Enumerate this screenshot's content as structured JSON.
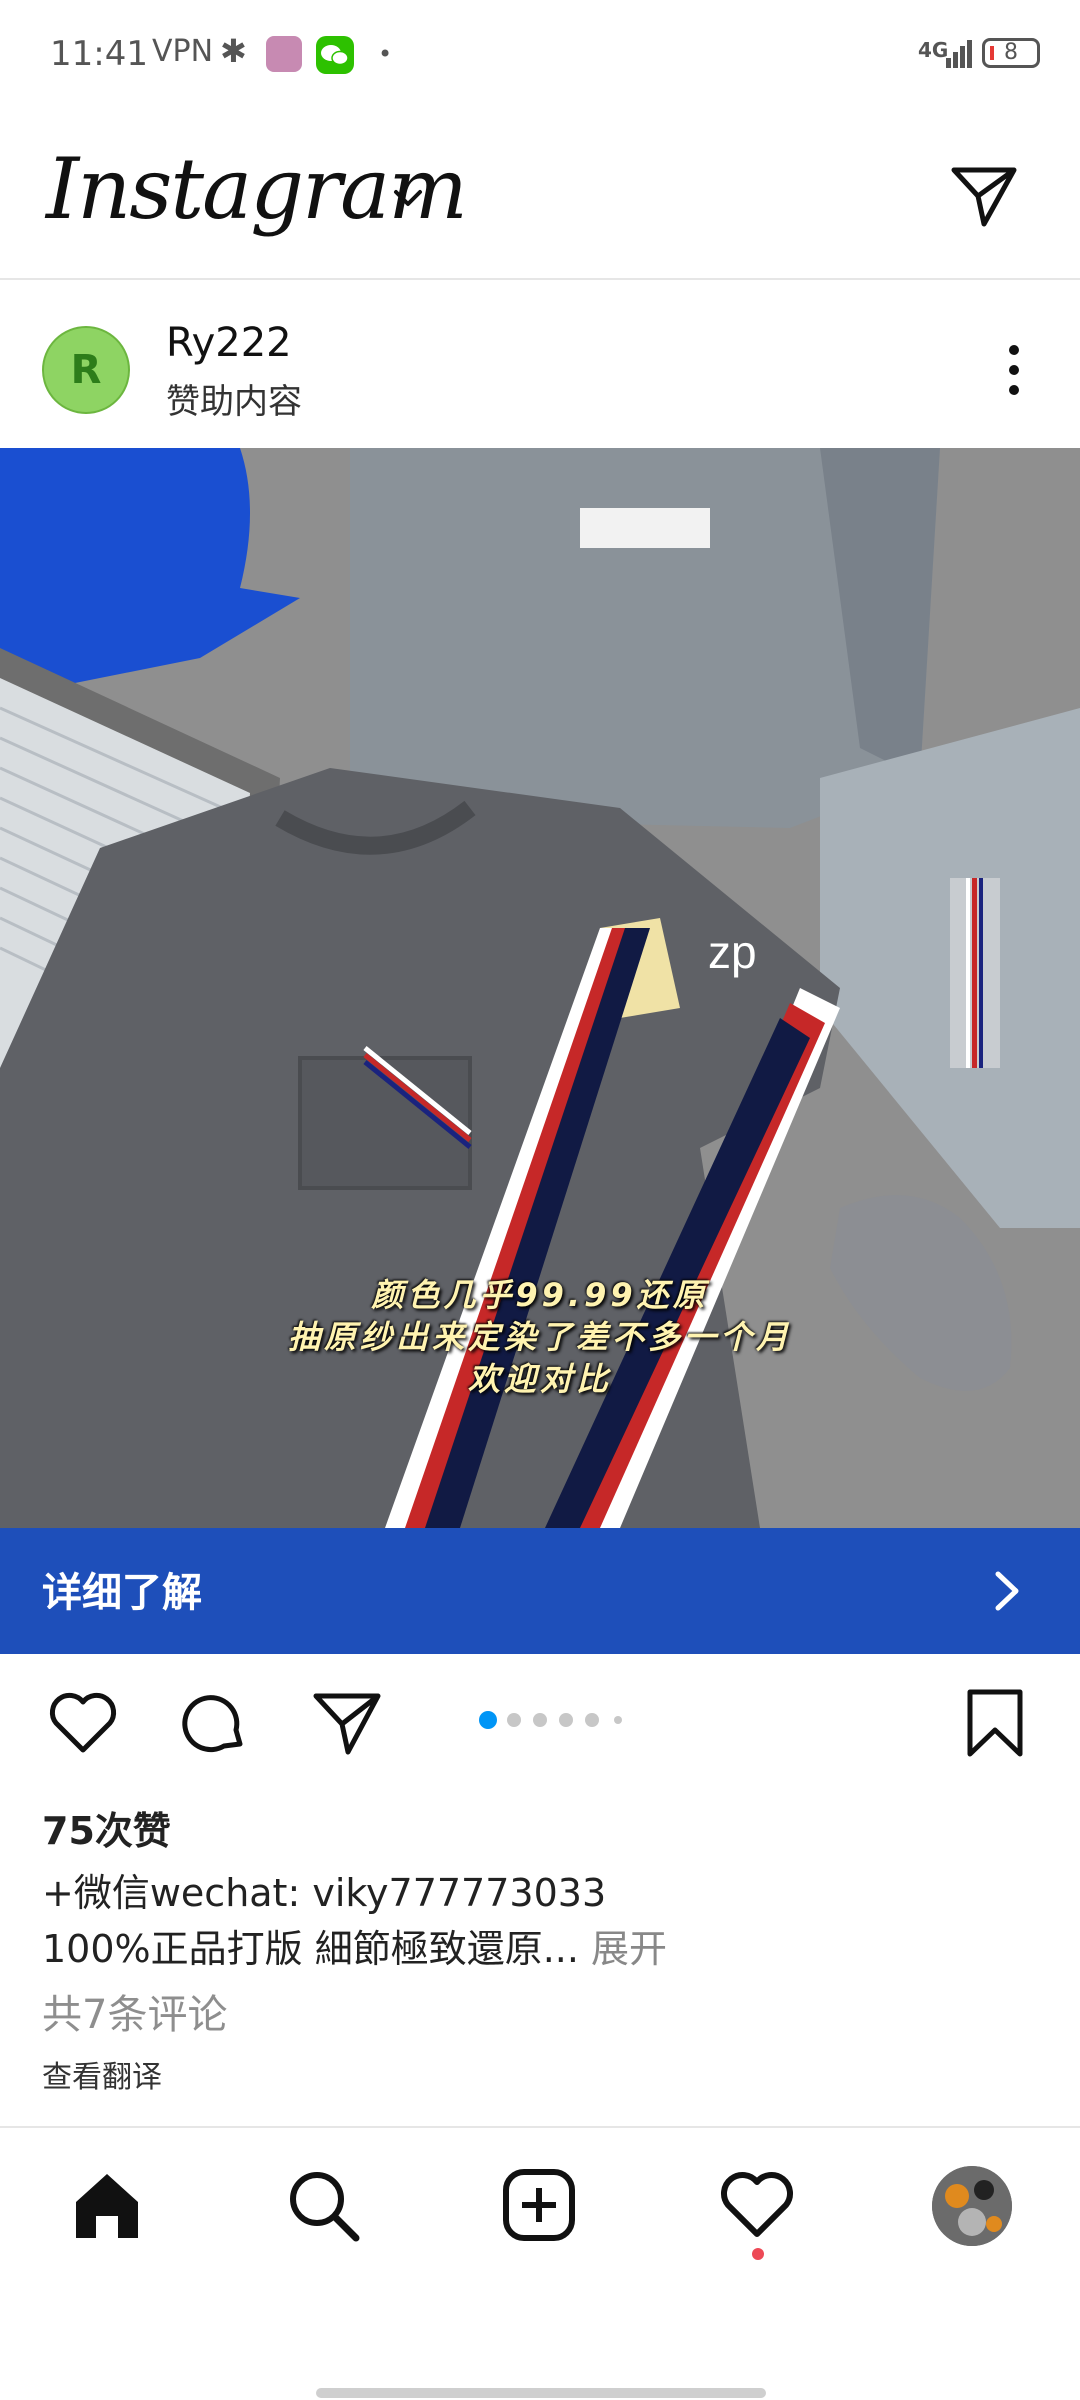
{
  "status_bar": {
    "time": "11:41",
    "vpn": "VPN",
    "network": "4G",
    "battery": "8"
  },
  "header": {
    "logo": "Instagram",
    "icons": [
      "chevron-down-icon",
      "direct-message-icon"
    ]
  },
  "post": {
    "avatar_initial": "R",
    "username": "Ry222",
    "sponsored_label": "赞助内容",
    "image": {
      "watermark": "zp",
      "caption_lines": [
        "颜色几乎99.99还原",
        "抽原纱出来定染了差不多一个月",
        "欢迎对比"
      ]
    },
    "cta_label": "详细了解",
    "likes": "75次赞",
    "caption_line1": "+微信wechat: viky777773033",
    "caption_line2": "100%正品打版 細節極致還原...",
    "caption_more": " 展开",
    "comments": "共7条评论",
    "translate": "查看翻译",
    "carousel": {
      "count": 6,
      "active": 0
    }
  },
  "colors": {
    "cta_background": "#1e4fba",
    "carousel_active": "#0095f6",
    "notification_dot": "#ed4956"
  },
  "bottom_nav": [
    "home-icon",
    "search-icon",
    "create-post-icon",
    "activity-heart-icon",
    "profile-avatar"
  ]
}
